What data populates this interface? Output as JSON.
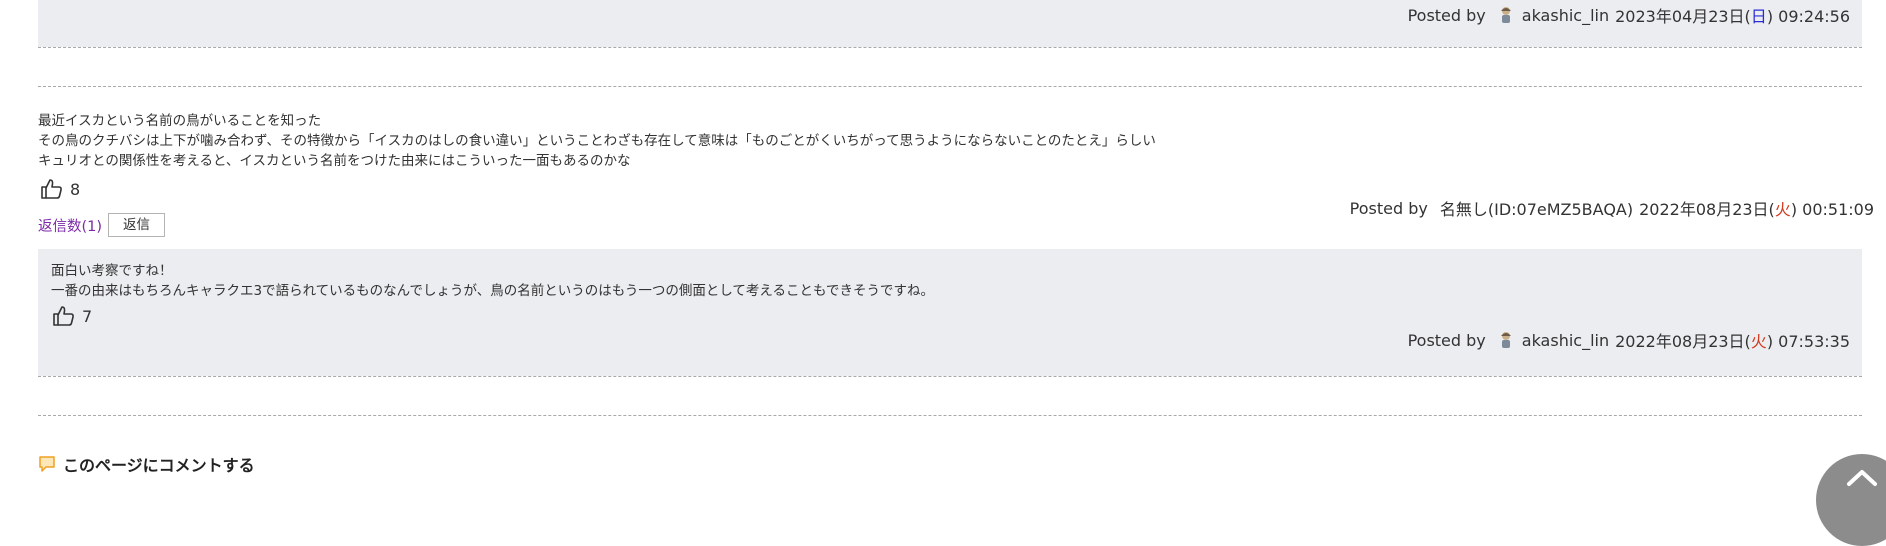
{
  "top_reply": {
    "posted_by_label": "Posted by",
    "author": "akashic_lin",
    "date_prefix": "2023年04月23日(",
    "weekday": "日",
    "date_suffix": ") 09:24:56"
  },
  "comment": {
    "lines": [
      "最近イスカという名前の鳥がいることを知った",
      "その鳥のクチバシは上下が噛み合わず、その特徴から「イスカのはしの食い違い」ということわざも存在して意味は「ものごとがくいちがって思うようにならないことのたとえ」らしい",
      "キュリオとの関係性を考えると、イスカという名前をつけた由来にはこういった一面もあるのかな"
    ],
    "likes": "8",
    "posted_by_label": "Posted by",
    "author": "名無し(ID:07eMZ5BAQA)",
    "date_prefix": "2022年08月23日(",
    "weekday": "火",
    "date_suffix": ") 00:51:09",
    "reply_count_label": "返信数(1)",
    "reply_button_label": "返信"
  },
  "reply": {
    "lines": [
      "面白い考察ですね！",
      "一番の由来はもちろんキャラクエ3で語られているものなんでしょうが、鳥の名前というのはもう一つの側面として考えることもできそうですね。"
    ],
    "likes": "7",
    "posted_by_label": "Posted by",
    "author": "akashic_lin",
    "date_prefix": "2022年08月23日(",
    "weekday": "火",
    "date_suffix": ") 07:53:35"
  },
  "comment_section": {
    "title": "このページにコメントする"
  },
  "icons": {
    "like": "thumbs-up-icon",
    "comment": "speech-bubble-icon",
    "avatar": "user-avatar-icon",
    "scroll_top": "scroll-to-top-icon"
  },
  "colors": {
    "gray_block": "#ebedf0",
    "reply_count_link": "#7a2aa8",
    "sunday": "#2b2bd6",
    "tuesday": "#d23a1f",
    "comment_icon": "#f0a020"
  }
}
